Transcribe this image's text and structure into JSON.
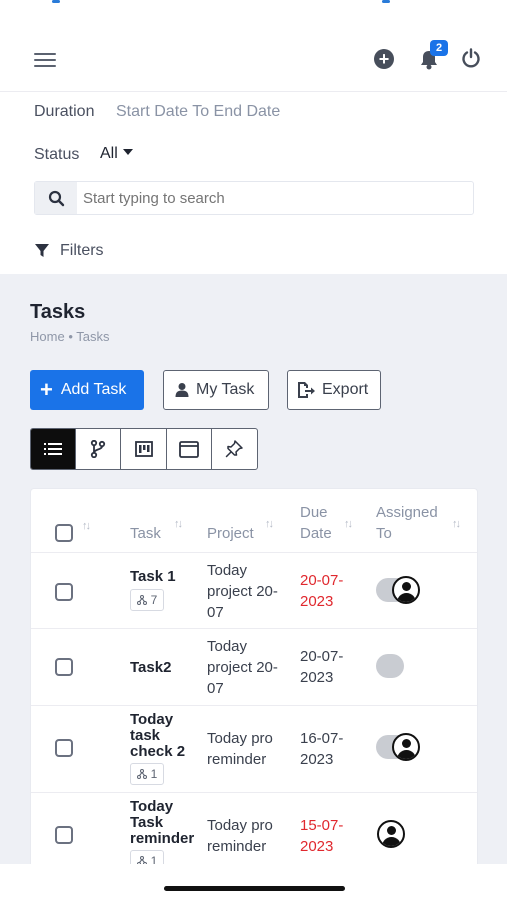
{
  "topbar": {
    "notification_count": "2"
  },
  "filters": {
    "duration_label": "Duration",
    "duration_value": "Start Date To End Date",
    "status_label": "Status",
    "status_value": "All",
    "search_placeholder": "Start typing to search",
    "filters_label": "Filters"
  },
  "page": {
    "title": "Tasks",
    "breadcrumb": [
      "Home",
      "•",
      "Tasks"
    ]
  },
  "actions": {
    "add_task": "Add Task",
    "my_task": "My Task",
    "export": "Export"
  },
  "views": [
    "list-view",
    "git-branch-view",
    "kanban-view",
    "calendar-view",
    "pin-view"
  ],
  "table": {
    "columns": {
      "task": "Task",
      "project": "Project",
      "due_date_1": "Due",
      "due_date_2": "Date",
      "assigned_1": "Assigned",
      "assigned_2": "To"
    },
    "rows": [
      {
        "task_lines": [
          "Task 1"
        ],
        "subtasks": "7",
        "project_lines": [
          "Today",
          "project 20-",
          "07"
        ],
        "due_lines": [
          "20-07-",
          "2023"
        ],
        "overdue": true,
        "assignees": [
          "toggle",
          "avatar"
        ]
      },
      {
        "task_lines": [
          "Task2"
        ],
        "subtasks": "",
        "project_lines": [
          "Today",
          "project 20-",
          "07"
        ],
        "due_lines": [
          "20-07-",
          "2023"
        ],
        "overdue": false,
        "assignees": [
          "toggle"
        ]
      },
      {
        "task_lines": [
          "Today",
          "task",
          "check 2"
        ],
        "subtasks": "1",
        "project_lines": [
          "Today pro",
          "reminder"
        ],
        "due_lines": [
          "16-07-",
          "2023"
        ],
        "overdue": false,
        "assignees": [
          "toggle",
          "avatar"
        ]
      },
      {
        "task_lines": [
          "Today",
          "Task",
          "reminder"
        ],
        "subtasks": "1",
        "project_lines": [
          "Today pro",
          "reminder"
        ],
        "due_lines": [
          "15-07-",
          "2023"
        ],
        "overdue": true,
        "assignees": [
          "avatar"
        ]
      }
    ]
  },
  "colors": {
    "accent": "#1a73e8",
    "overdue": "#e0282e",
    "page_bg": "#eef0f5"
  }
}
